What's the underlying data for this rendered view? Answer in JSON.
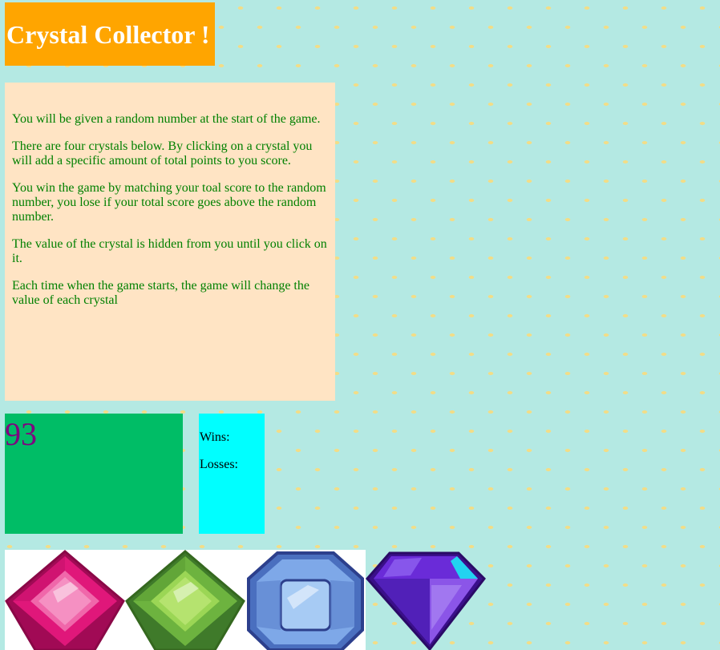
{
  "header": {
    "title": "Crystal Collector !"
  },
  "instructions": [
    "You will be given a random number at the start of the game.",
    "There are four crystals below. By clicking on a crystal you will add a specific amount of total points to you score.",
    "You win the game by matching your toal score to the random number, you lose if your total score goes above the random number.",
    "The value of the crystal is hidden from you until you click on it.",
    "Each time when the game starts, the game will change the value of each crystal"
  ],
  "game": {
    "random_number": "93",
    "wins_label": "Wins:",
    "losses_label": "Losses:"
  },
  "crystals": [
    {
      "name": "pink-crystal",
      "color": "#e0177a"
    },
    {
      "name": "green-crystal",
      "color": "#7cc243"
    },
    {
      "name": "blue-crystal",
      "color": "#6f9ee0"
    },
    {
      "name": "purple-crystal",
      "color": "#6a2bd8"
    }
  ],
  "colors": {
    "page_background": "#b4e9e3",
    "title_background": "#ffa500",
    "instructions_background": "#ffe4c4",
    "instructions_text": "#008000",
    "target_background": "#00bd66",
    "target_text": "#800080",
    "score_background": "#00ffff"
  }
}
